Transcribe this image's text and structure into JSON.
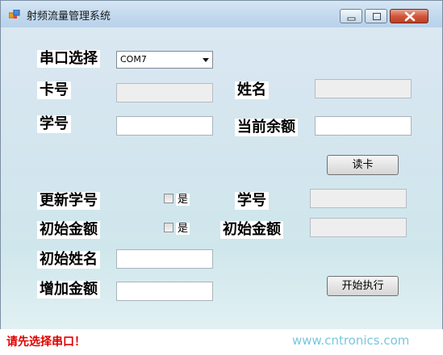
{
  "window": {
    "title": "射频流量管理系统"
  },
  "port": {
    "label": "串口选择",
    "selected": "COM7"
  },
  "card_no": {
    "label": "卡号",
    "value": ""
  },
  "name": {
    "label": "姓名",
    "value": ""
  },
  "student_id": {
    "label": "学号",
    "value": ""
  },
  "balance": {
    "label": "当前余额",
    "value": ""
  },
  "read_card_button": "读卡",
  "update_id": {
    "label": "更新学号",
    "checkbox_label": "是",
    "checked": false,
    "field_label": "学号",
    "value": ""
  },
  "init_amount": {
    "label": "初始金额",
    "checkbox_label": "是",
    "checked": false,
    "field_label": "初始金额",
    "value": ""
  },
  "init_name": {
    "label": "初始姓名",
    "value": ""
  },
  "add_amount": {
    "label": "增加金额",
    "value": ""
  },
  "execute_button": "开始执行",
  "status_text": "请先选择串口！",
  "watermark": "www.cntronics.com",
  "colors": {
    "status_error": "#e00000",
    "watermark": "#79c7de"
  }
}
